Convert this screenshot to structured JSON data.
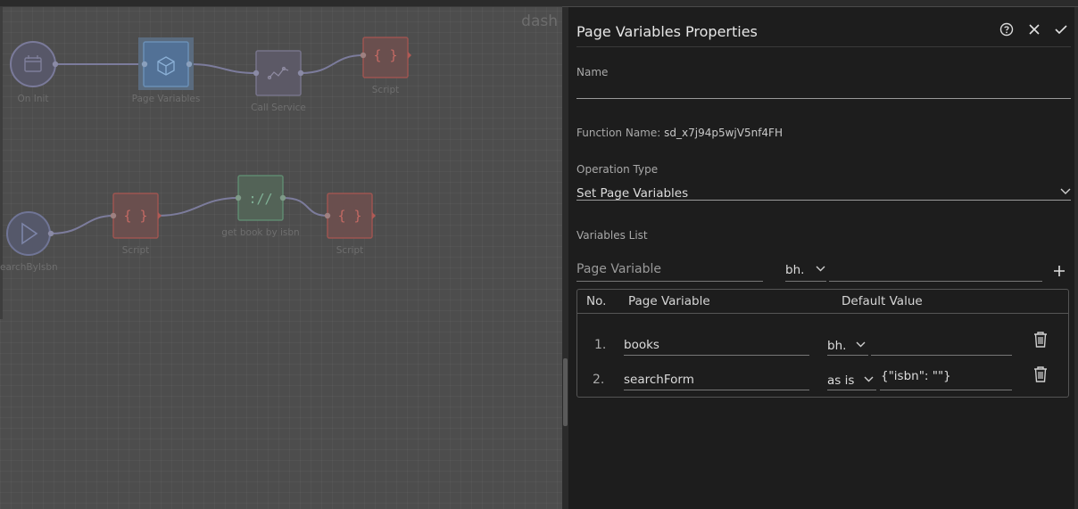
{
  "canvas": {
    "brand": "dash",
    "nodes": [
      {
        "id": "on-init",
        "label": "On Init",
        "kind": "event"
      },
      {
        "id": "page-variables",
        "label": "Page Variables",
        "kind": "page-variables"
      },
      {
        "id": "call-service",
        "label": "Call Service",
        "kind": "service"
      },
      {
        "id": "script-1",
        "label": "Script",
        "kind": "script"
      },
      {
        "id": "search-by-isbn",
        "label": "earchByIsbn",
        "kind": "trigger"
      },
      {
        "id": "script-2",
        "label": "Script",
        "kind": "script"
      },
      {
        "id": "get-book",
        "label": "get book by isbn",
        "kind": "api"
      },
      {
        "id": "script-3",
        "label": "Script",
        "kind": "script"
      }
    ],
    "icon_glyphs": {
      "script": "{ }",
      "api": "://"
    },
    "colors": {
      "event": "#6b6b8a",
      "page_variables": "#4f7ea5",
      "service": "#6e6a7a",
      "script": "#a0504b",
      "api": "#4f7a66",
      "edge": "#7c7c9c"
    }
  },
  "panel": {
    "title": "Page Variables Properties",
    "header_icons": [
      "help-icon",
      "close-icon",
      "check-icon"
    ],
    "name_label": "Name",
    "name_value": "",
    "function_name_label": "Function Name:",
    "function_name_value": "sd_x7j94p5wjV5nf4FH",
    "operation_type_label": "Operation Type",
    "operation_type_value": "Set Page Variables",
    "variables_list_label": "Variables List",
    "new_var": {
      "placeholder": "Page Variable",
      "type": "bh.",
      "value": ""
    },
    "table": {
      "headers": {
        "no": "No.",
        "page_variable": "Page Variable",
        "default_value": "Default Value"
      },
      "rows": [
        {
          "no": "1.",
          "name": "books",
          "type": "bh.",
          "default": ""
        },
        {
          "no": "2.",
          "name": "searchForm",
          "type": "as is",
          "default": "{\"isbn\": \"\"}"
        }
      ]
    }
  }
}
